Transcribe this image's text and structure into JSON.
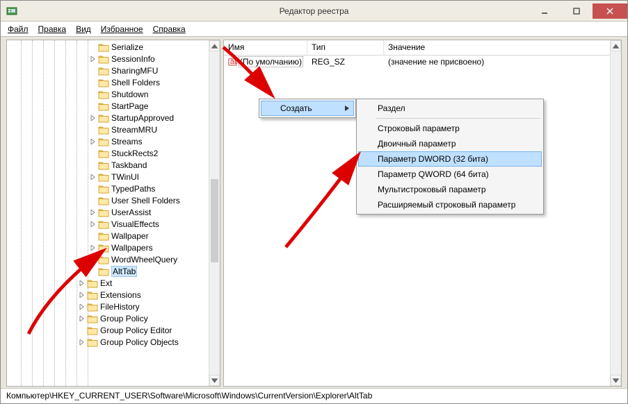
{
  "window": {
    "title": "Редактор реестра"
  },
  "menu": {
    "file": "Файл",
    "edit": "Правка",
    "view": "Вид",
    "favorites": "Избранное",
    "help": "Справка"
  },
  "tree": {
    "items": [
      {
        "label": "Serialize",
        "expandable": false
      },
      {
        "label": "SessionInfo",
        "expandable": true
      },
      {
        "label": "SharingMFU",
        "expandable": false
      },
      {
        "label": "Shell Folders",
        "expandable": false
      },
      {
        "label": "Shutdown",
        "expandable": false
      },
      {
        "label": "StartPage",
        "expandable": false
      },
      {
        "label": "StartupApproved",
        "expandable": true
      },
      {
        "label": "StreamMRU",
        "expandable": false
      },
      {
        "label": "Streams",
        "expandable": true
      },
      {
        "label": "StuckRects2",
        "expandable": false
      },
      {
        "label": "Taskband",
        "expandable": false
      },
      {
        "label": "TWinUI",
        "expandable": true
      },
      {
        "label": "TypedPaths",
        "expandable": false
      },
      {
        "label": "User Shell Folders",
        "expandable": false
      },
      {
        "label": "UserAssist",
        "expandable": true
      },
      {
        "label": "VisualEffects",
        "expandable": true
      },
      {
        "label": "Wallpaper",
        "expandable": false
      },
      {
        "label": "Wallpapers",
        "expandable": true
      },
      {
        "label": "WordWheelQuery",
        "expandable": true
      },
      {
        "label": "AltTab",
        "expandable": false,
        "selected": true
      },
      {
        "label": "Ext",
        "expandable": true,
        "depth": -1
      },
      {
        "label": "Extensions",
        "expandable": true,
        "depth": -1
      },
      {
        "label": "FileHistory",
        "expandable": true,
        "depth": -1
      },
      {
        "label": "Group Policy",
        "expandable": true,
        "depth": -1
      },
      {
        "label": "Group Policy Editor",
        "expandable": false,
        "depth": -1
      },
      {
        "label": "Group Policy Objects",
        "expandable": true,
        "depth": -1
      }
    ]
  },
  "list": {
    "columns": {
      "name": "Имя",
      "type": "Тип",
      "value": "Значение"
    },
    "rows": [
      {
        "name": "(По умолчанию)",
        "type": "REG_SZ",
        "value": "(значение не присвоено)"
      }
    ]
  },
  "contextmenu": {
    "parent": {
      "create": "Создать"
    },
    "submenu": {
      "key": "Раздел",
      "string": "Строковый параметр",
      "binary": "Двоичный параметр",
      "dword": "Параметр DWORD (32 бита)",
      "qword": "Параметр QWORD (64 бита)",
      "multistring": "Мультистроковый параметр",
      "expandstring": "Расширяемый строковый параметр"
    }
  },
  "statusbar": {
    "path": "Компьютер\\HKEY_CURRENT_USER\\Software\\Microsoft\\Windows\\CurrentVersion\\Explorer\\AltTab"
  }
}
